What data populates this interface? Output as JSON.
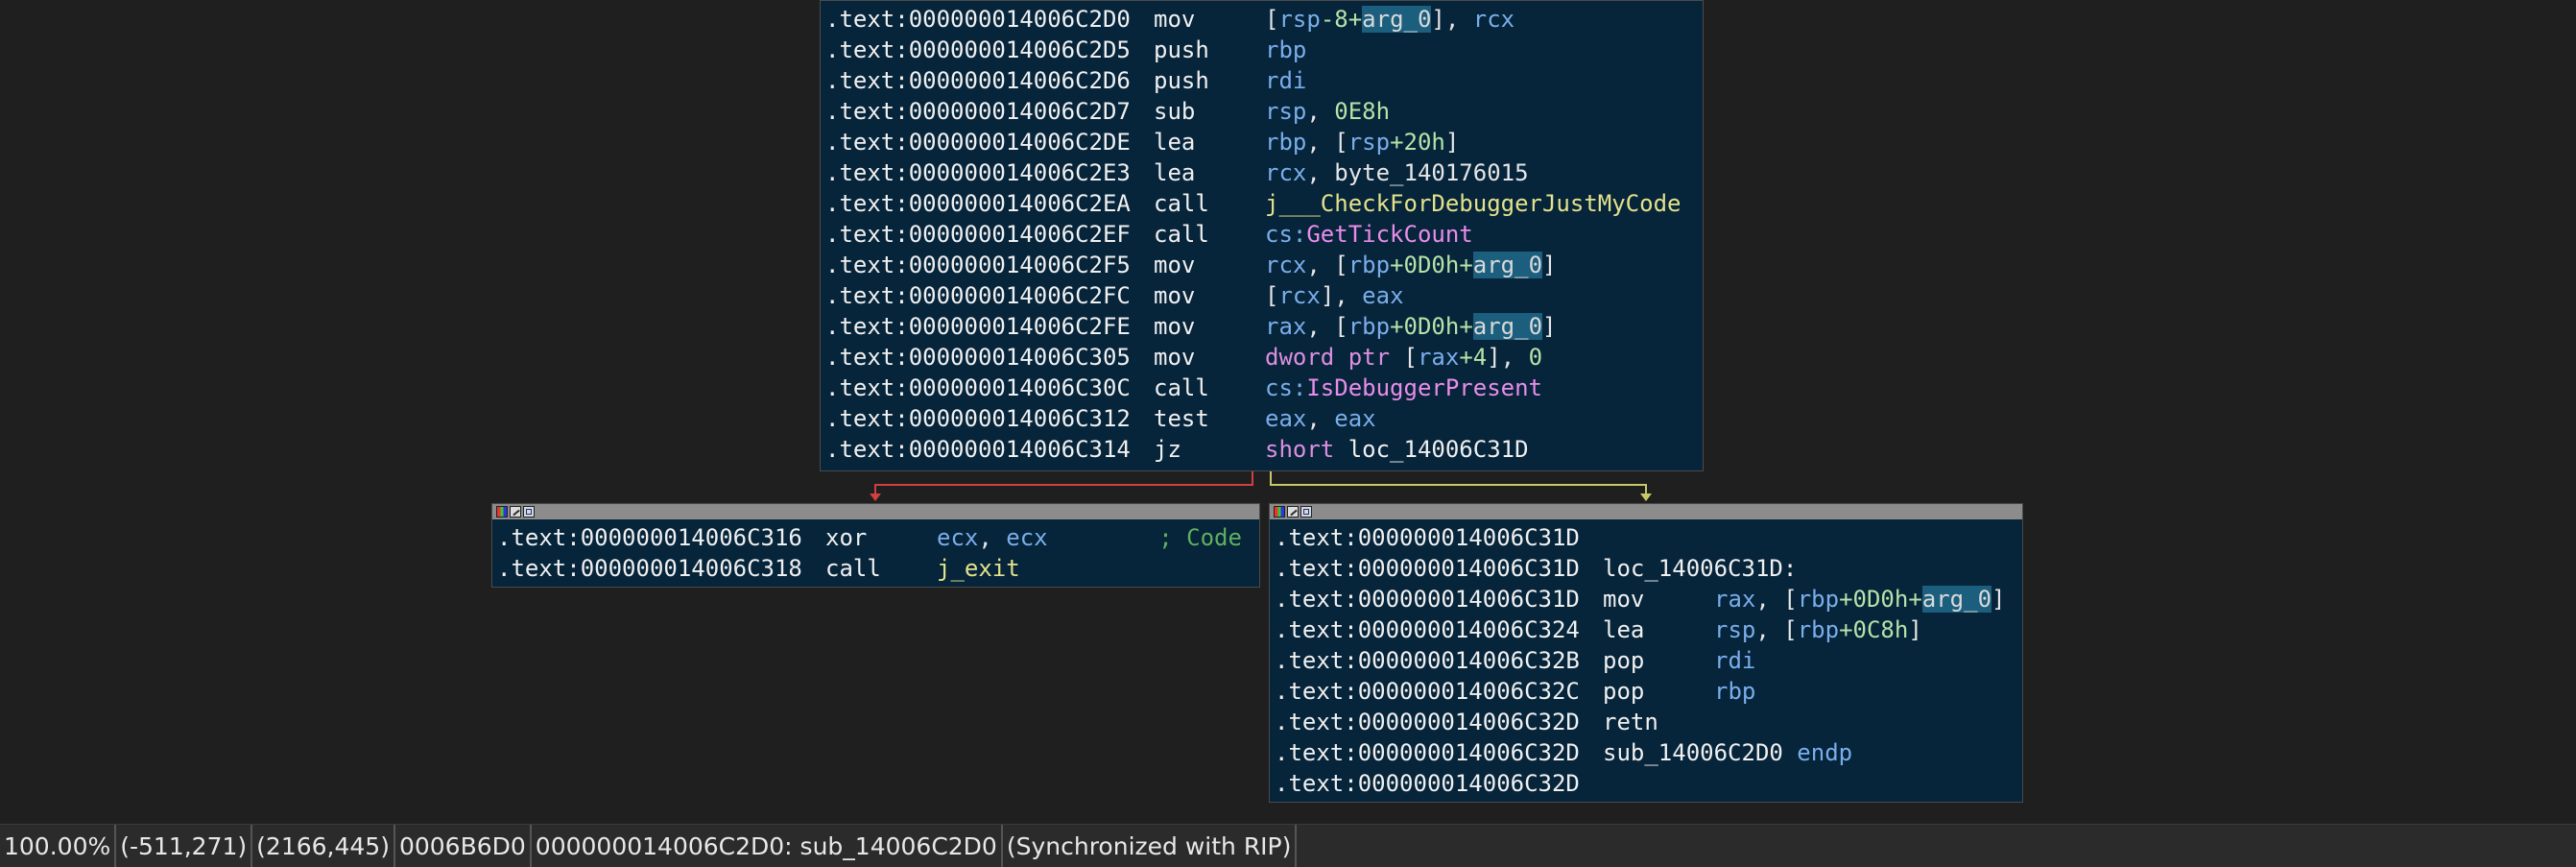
{
  "colors": {
    "background": "#1f1f1f",
    "block_background": "#06243a",
    "title_bar": "#8c8c8c",
    "edge_taken": "#d04040",
    "edge_fallthrough": "#c8c868",
    "register": "#7aaeea",
    "number": "#b5e3a8",
    "variable_highlight": "#1b5e7d",
    "function_name": "#e4e28a",
    "import_name": "#ea8dea",
    "comment": "#5fb05f"
  },
  "blocks": [
    {
      "name": "block-entry",
      "has_titlebar": false,
      "lines": [
        {
          "addr": ".text:000000014006C2D0",
          "mn": "mov",
          "ops": [
            [
              "[",
              "pun"
            ],
            [
              "rsp",
              "reg"
            ],
            [
              "-8+",
              "num"
            ],
            [
              "arg_0",
              "var"
            ],
            [
              "], ",
              "pun"
            ],
            [
              "rcx",
              "reg"
            ]
          ]
        },
        {
          "addr": ".text:000000014006C2D5",
          "mn": "push",
          "ops": [
            [
              "rbp",
              "reg"
            ]
          ]
        },
        {
          "addr": ".text:000000014006C2D6",
          "mn": "push",
          "ops": [
            [
              "rdi",
              "reg"
            ]
          ]
        },
        {
          "addr": ".text:000000014006C2D7",
          "mn": "sub",
          "ops": [
            [
              "rsp",
              "reg"
            ],
            [
              ", ",
              "pun"
            ],
            [
              "0E8h",
              "num"
            ]
          ]
        },
        {
          "addr": ".text:000000014006C2DE",
          "mn": "lea",
          "ops": [
            [
              "rbp",
              "reg"
            ],
            [
              ", [",
              "pun"
            ],
            [
              "rsp",
              "reg"
            ],
            [
              "+20h",
              "num"
            ],
            [
              "]",
              "pun"
            ]
          ]
        },
        {
          "addr": ".text:000000014006C2E3",
          "mn": "lea",
          "ops": [
            [
              "rcx",
              "reg"
            ],
            [
              ", byte_140176015",
              "sym"
            ]
          ]
        },
        {
          "addr": ".text:000000014006C2EA",
          "mn": "call",
          "ops": [
            [
              "j___CheckForDebuggerJustMyCode",
              "fn"
            ]
          ]
        },
        {
          "addr": ".text:000000014006C2EF",
          "mn": "call",
          "ops": [
            [
              "cs:",
              "reg"
            ],
            [
              "GetTickCount",
              "imp"
            ]
          ]
        },
        {
          "addr": ".text:000000014006C2F5",
          "mn": "mov",
          "ops": [
            [
              "rcx",
              "reg"
            ],
            [
              ", [",
              "pun"
            ],
            [
              "rbp",
              "reg"
            ],
            [
              "+0D0h+",
              "num"
            ],
            [
              "arg_0",
              "var"
            ],
            [
              "]",
              "pun"
            ]
          ]
        },
        {
          "addr": ".text:000000014006C2FC",
          "mn": "mov",
          "ops": [
            [
              "[",
              "pun"
            ],
            [
              "rcx",
              "reg"
            ],
            [
              "], ",
              "pun"
            ],
            [
              "eax",
              "reg"
            ]
          ]
        },
        {
          "addr": ".text:000000014006C2FE",
          "mn": "mov",
          "ops": [
            [
              "rax",
              "reg"
            ],
            [
              ", [",
              "pun"
            ],
            [
              "rbp",
              "reg"
            ],
            [
              "+0D0h+",
              "num"
            ],
            [
              "arg_0",
              "var"
            ],
            [
              "]",
              "pun"
            ]
          ]
        },
        {
          "addr": ".text:000000014006C305",
          "mn": "mov",
          "ops": [
            [
              "dword ptr ",
              "kw"
            ],
            [
              "[",
              "pun"
            ],
            [
              "rax",
              "reg"
            ],
            [
              "+4",
              "num"
            ],
            [
              "], ",
              "pun"
            ],
            [
              "0",
              "num"
            ]
          ]
        },
        {
          "addr": ".text:000000014006C30C",
          "mn": "call",
          "ops": [
            [
              "cs:",
              "reg"
            ],
            [
              "IsDebuggerPresent",
              "imp"
            ]
          ]
        },
        {
          "addr": ".text:000000014006C312",
          "mn": "test",
          "ops": [
            [
              "eax",
              "reg"
            ],
            [
              ", ",
              "pun"
            ],
            [
              "eax",
              "reg"
            ]
          ]
        },
        {
          "addr": ".text:000000014006C314",
          "mn": "jz",
          "ops": [
            [
              "short ",
              "kw"
            ],
            [
              "loc_14006C31D",
              "lab"
            ]
          ]
        }
      ]
    },
    {
      "name": "block-exit",
      "has_titlebar": true,
      "lines": [
        {
          "addr": ".text:000000014006C316",
          "mn": "xor",
          "ops": [
            [
              "ecx",
              "reg"
            ],
            [
              ", ",
              "pun"
            ],
            [
              "ecx",
              "reg"
            ],
            [
              "        ; Code",
              "cmt"
            ]
          ]
        },
        {
          "addr": ".text:000000014006C318",
          "mn": "call",
          "ops": [
            [
              "j_exit",
              "fn"
            ]
          ]
        }
      ]
    },
    {
      "name": "block-return",
      "has_titlebar": true,
      "lines": [
        {
          "addr": ".text:000000014006C31D",
          "mn": "",
          "ops": []
        },
        {
          "addr": ".text:000000014006C31D",
          "raw": [
            [
              "loc_14006C31D:",
              "lab"
            ]
          ]
        },
        {
          "addr": ".text:000000014006C31D",
          "mn": "mov",
          "ops": [
            [
              "rax",
              "reg"
            ],
            [
              ", [",
              "pun"
            ],
            [
              "rbp",
              "reg"
            ],
            [
              "+0D0h+",
              "num"
            ],
            [
              "arg_0",
              "var"
            ],
            [
              "]",
              "pun"
            ]
          ]
        },
        {
          "addr": ".text:000000014006C324",
          "mn": "lea",
          "ops": [
            [
              "rsp",
              "reg"
            ],
            [
              ", [",
              "pun"
            ],
            [
              "rbp",
              "reg"
            ],
            [
              "+0C8h",
              "num"
            ],
            [
              "]",
              "pun"
            ]
          ]
        },
        {
          "addr": ".text:000000014006C32B",
          "mn": "pop",
          "ops": [
            [
              "rdi",
              "reg"
            ]
          ]
        },
        {
          "addr": ".text:000000014006C32C",
          "mn": "pop",
          "ops": [
            [
              "rbp",
              "reg"
            ]
          ]
        },
        {
          "addr": ".text:000000014006C32D",
          "mn": "retn",
          "ops": []
        },
        {
          "addr": ".text:000000014006C32D",
          "raw": [
            [
              "sub_14006C2D0 ",
              "lab"
            ],
            [
              "endp",
              "endp"
            ]
          ]
        },
        {
          "addr": ".text:000000014006C32D",
          "mn": "",
          "ops": []
        }
      ]
    }
  ],
  "status": {
    "zoom": "100.00%",
    "cursor": "(-511,271)",
    "graph_pos": "(2166,445)",
    "offset": "0006B6D0",
    "location": "000000014006C2D0: sub_14006C2D0",
    "sync": "(Synchronized with RIP)"
  }
}
